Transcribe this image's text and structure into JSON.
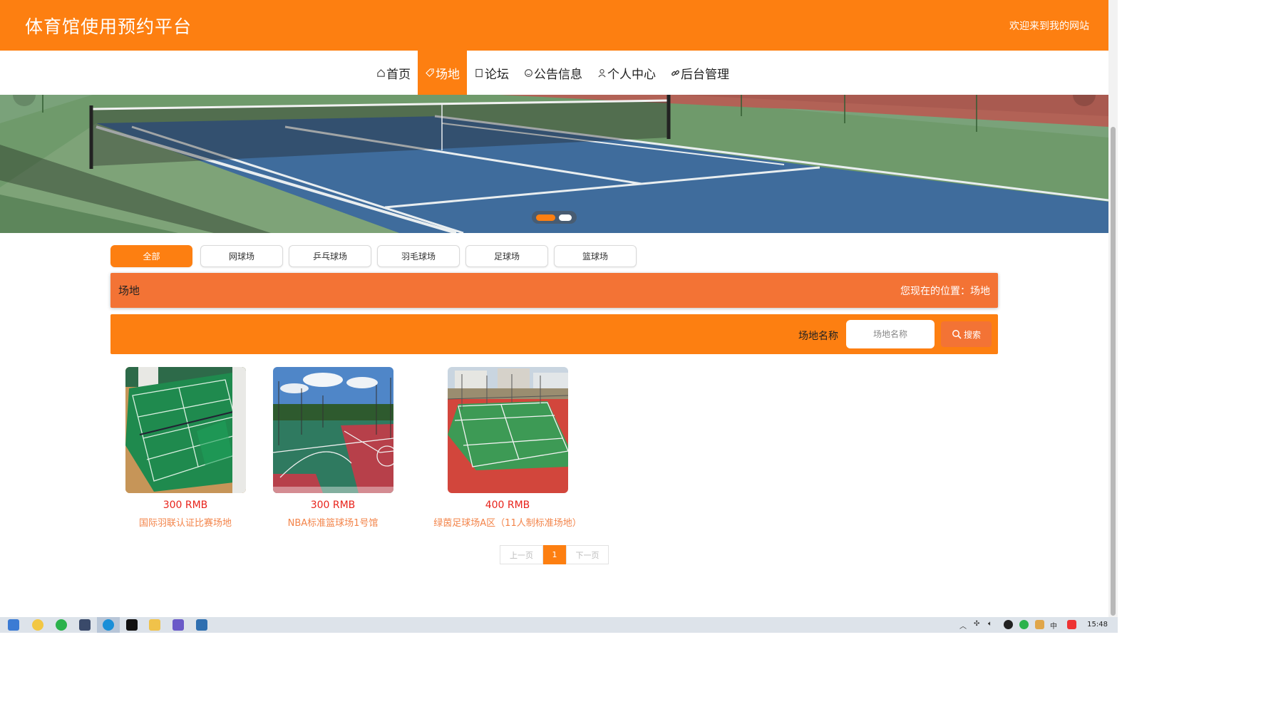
{
  "header": {
    "site_title": "体育馆使用预约平台",
    "welcome": "欢迎来到我的网站"
  },
  "nav": {
    "items": [
      {
        "label": "首页",
        "icon": "home-icon",
        "active": false
      },
      {
        "label": "场地",
        "icon": "tag-icon",
        "active": true
      },
      {
        "label": "论坛",
        "icon": "square-icon",
        "active": false
      },
      {
        "label": "公告信息",
        "icon": "smile-icon",
        "active": false
      },
      {
        "label": "个人中心",
        "icon": "user-icon",
        "active": false
      },
      {
        "label": "后台管理",
        "icon": "link-icon",
        "active": false
      }
    ]
  },
  "banner": {
    "slide_count": 2,
    "active_slide": 1
  },
  "filters": {
    "items": [
      "全部",
      "网球场",
      "乒乓球场",
      "羽毛球场",
      "足球场",
      "篮球场"
    ],
    "active": "全部"
  },
  "section": {
    "title": "场地",
    "location": "您现在的位置：场地"
  },
  "search": {
    "label": "场地名称",
    "placeholder": "场地名称",
    "button_label": "搜索"
  },
  "venues": [
    {
      "price": "300 RMB",
      "name": "国际羽联认证比赛场地"
    },
    {
      "price": "300 RMB",
      "name": "NBA标准篮球场1号馆"
    },
    {
      "price": "400 RMB",
      "name": "绿茵足球场A区（11人制标准场地）"
    }
  ],
  "pagination": {
    "prev": "上一页",
    "current": "1",
    "next": "下一页"
  },
  "taskbar": {
    "clock": "15:48",
    "ime": "中"
  },
  "colors": {
    "primary": "#fd7f11",
    "section": "#f37335",
    "price": "#e8231b",
    "name": "#f3844a"
  }
}
